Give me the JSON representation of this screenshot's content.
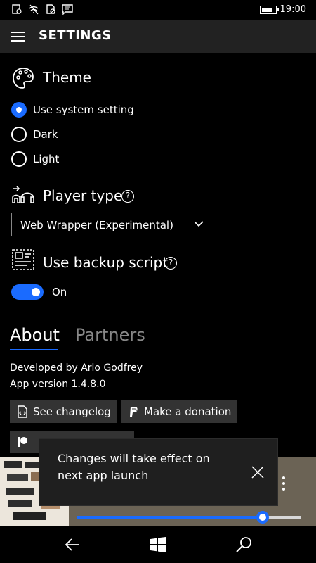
{
  "status_bar": {
    "icons": [
      "notification-icon",
      "wifi-icon",
      "no-sim-icon",
      "message-icon"
    ],
    "battery_level": 0.85,
    "time": "19:00"
  },
  "header": {
    "title": "SETTINGS",
    "menu_icon": "hamburger-icon"
  },
  "theme": {
    "heading": "Theme",
    "icon": "palette-icon",
    "options": [
      {
        "label": "Use system setting",
        "selected": true
      },
      {
        "label": "Dark",
        "selected": false
      },
      {
        "label": "Light",
        "selected": false
      }
    ]
  },
  "player_type": {
    "heading": "Player type",
    "icon": "headphones-switch-icon",
    "help": "?",
    "selected": "Web Wrapper (Experimental)"
  },
  "backup_script": {
    "heading": "Use backup script",
    "icon": "script-icon",
    "help": "?",
    "toggle_on": true,
    "toggle_label": "On"
  },
  "tabs": [
    {
      "label": "About",
      "active": true
    },
    {
      "label": "Partners",
      "active": false
    }
  ],
  "about": {
    "developer": "Developed by Arlo Godfrey",
    "version": "App version 1.4.8.0",
    "buttons": {
      "changelog": "See changelog",
      "donation": "Make a donation"
    }
  },
  "toast": {
    "message": "Changes will take effect on next app launch"
  },
  "now_playing": {
    "progress": 0.83
  },
  "colors": {
    "accent": "#1a6bff",
    "background": "#000000",
    "header": "#222222"
  }
}
